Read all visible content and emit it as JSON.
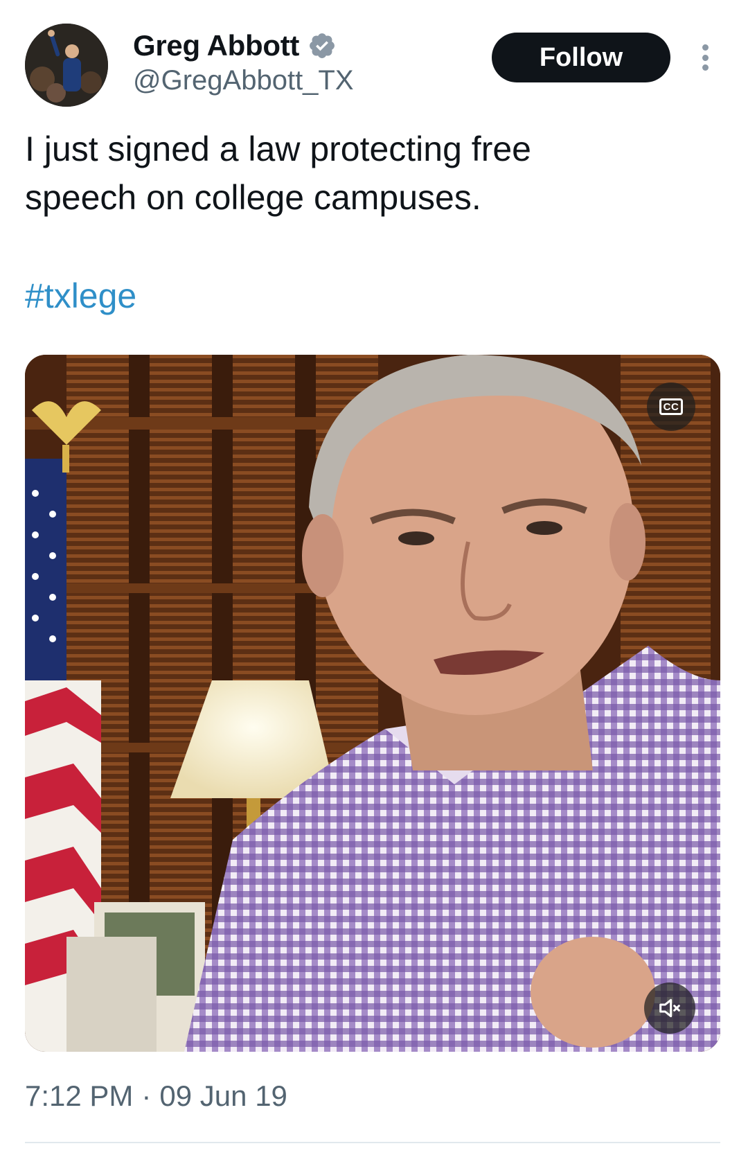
{
  "author": {
    "display_name": "Greg Abbott",
    "handle": "@GregAbbott_TX",
    "verified": true,
    "verified_color": "#8b98a5",
    "avatar_icon": "profile-photo"
  },
  "actions": {
    "follow_label": "Follow",
    "more_icon": "more-vertical-icon"
  },
  "tweet": {
    "text": "I just signed a law protecting free\nspeech on college campuses.",
    "hashtag": "#txlege",
    "hashtag_color": "#2f8fc8"
  },
  "media": {
    "type": "video",
    "cc_label": "CC",
    "muted": true
  },
  "meta": {
    "time": "7:12 PM",
    "separator": "·",
    "date": "09 Jun 19"
  },
  "colors": {
    "text_primary": "#0f1419",
    "text_secondary": "#536471",
    "follow_bg": "#0f1419"
  }
}
